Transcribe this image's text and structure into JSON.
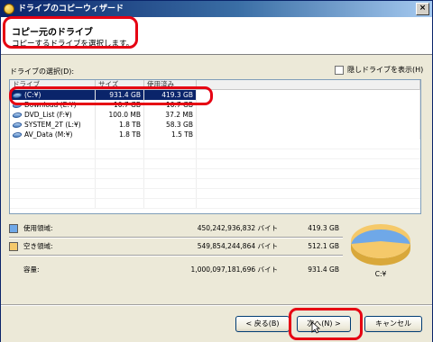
{
  "window": {
    "title": "ドライブのコピーウィザード",
    "close_glyph": "×"
  },
  "header": {
    "title": "コピー元のドライブ",
    "subtitle": "コピーするドライブを選択します。"
  },
  "drive_select": {
    "label": "ドライブの選択(D):",
    "hidden_checkbox_label": "隠しドライブを表示(H)",
    "columns": [
      "ドライブ",
      "サイズ",
      "使用済み"
    ],
    "rows": [
      {
        "name": "(C:¥)",
        "size": "931.4 GB",
        "used": "419.3 GB",
        "selected": true
      },
      {
        "name": "Download (E:¥)",
        "size": "10.7 GB",
        "used": "10.7 GB",
        "selected": false
      },
      {
        "name": "DVD_List (F:¥)",
        "size": "100.0 MB",
        "used": "37.2 MB",
        "selected": false
      },
      {
        "name": "SYSTEM_2T (L:¥)",
        "size": "1.8 TB",
        "used": "58.3 GB",
        "selected": false
      },
      {
        "name": "AV_Data (M:¥)",
        "size": "1.8 TB",
        "used": "1.5 TB",
        "selected": false
      }
    ]
  },
  "usage": {
    "used": {
      "label": "使用領域:",
      "bytes": "450,242,936,832 バイト",
      "size": "419.3 GB",
      "color": "#6fa8e8"
    },
    "free": {
      "label": "空き領域:",
      "bytes": "549,854,244,864 バイト",
      "size": "512.1 GB",
      "color": "#f5c96a"
    },
    "capacity": {
      "label": "容量:",
      "bytes": "1,000,097,181,696 バイト",
      "size": "931.4 GB"
    },
    "pie_label": "C:¥",
    "used_fraction": 0.45
  },
  "buttons": {
    "back": "< 戻る(B)",
    "next": "次へ(N) >",
    "cancel": "キャンセル"
  }
}
